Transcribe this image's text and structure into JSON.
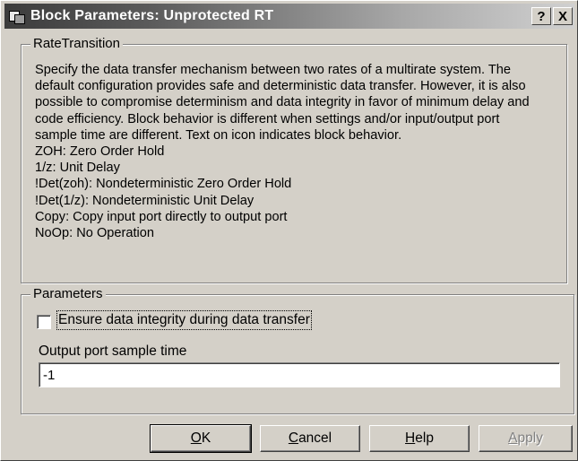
{
  "window": {
    "title": "Block Parameters: Unprotected RT",
    "help_button": "?",
    "close_button": "X"
  },
  "description_group": {
    "legend": "RateTransition",
    "text": "Specify the data transfer mechanism between two rates of a multirate system. The\ndefault configuration provides safe and deterministic data transfer. However, it is also\npossible to compromise determinism and data integrity in favor of minimum delay and\ncode efficiency. Block behavior is different when settings and/or input/output port\nsample time are different. Text on icon indicates block behavior.\nZOH: Zero Order Hold\n1/z: Unit Delay\n!Det(zoh): Nondeterministic Zero Order Hold\n!Det(1/z): Nondeterministic Unit Delay\nCopy: Copy input port directly to output port\nNoOp: No Operation"
  },
  "parameters_group": {
    "legend": "Parameters",
    "checkbox_label": "Ensure data integrity during data transfer",
    "checkbox_checked": false,
    "sample_time_label": "Output port sample time",
    "sample_time_value": "-1"
  },
  "buttons": {
    "ok": "OK",
    "cancel": "Cancel",
    "help": "Help",
    "apply": "Apply"
  }
}
